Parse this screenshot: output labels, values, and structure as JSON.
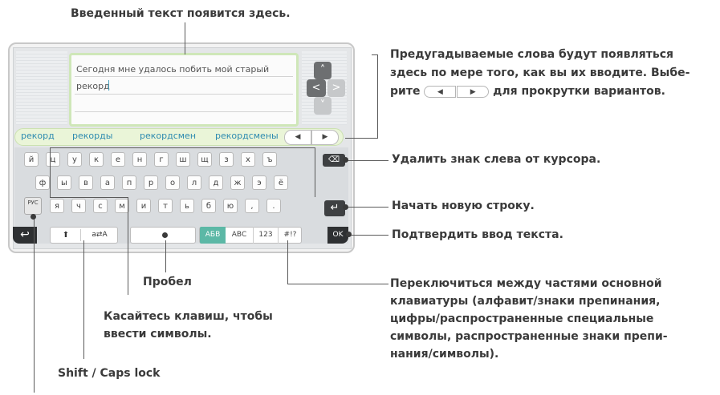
{
  "callouts": {
    "entered_text": "Введенный текст появится здесь.",
    "predicted_1": "Предугадываемые слова будут появляться",
    "predicted_2": "здесь по мере того, как вы их вводите. Выбе-",
    "predicted_3a": "рите",
    "predicted_3b": "для прокрутки вариантов.",
    "delete": "Удалить знак слева от курсора.",
    "newline": "Начать новую строку.",
    "confirm": "Подтвердить ввод текста.",
    "space": "Пробел",
    "switch_1": "Переключиться между частями основной",
    "switch_2": "клавиатуры (алфавит/знаки препинания,",
    "switch_3": "цифры/распространенные специальные",
    "switch_4": "символы, распространенные знаки препи-",
    "switch_5": "нания/символы).",
    "touch_1": "Касайтесь клавиш, чтобы",
    "touch_2": "ввести символы.",
    "shift": "Shift / Caps lock"
  },
  "textbox": {
    "line1": "Сегодня мне удалось побить мой старый",
    "line2": "рекорд"
  },
  "predictions": [
    "рекорд",
    "рекорды",
    "рекордсмен",
    "рекордсмены"
  ],
  "pred_nav": {
    "left": "◀",
    "right": "▶"
  },
  "inline_nav": {
    "left": "◀",
    "right": "▶"
  },
  "dpad": {
    "up": "˄",
    "left": "<",
    "right": ">",
    "down": "˅"
  },
  "keys": {
    "row1": [
      "й",
      "ц",
      "у",
      "к",
      "е",
      "н",
      "г",
      "ш",
      "щ",
      "з",
      "х",
      "ъ"
    ],
    "row2": [
      "ф",
      "ы",
      "в",
      "а",
      "п",
      "р",
      "о",
      "л",
      "д",
      "ж",
      "э",
      "ё"
    ],
    "row3": [
      "я",
      "ч",
      "с",
      "м",
      "и",
      "т",
      "ь",
      "б",
      "ю",
      ",",
      "."
    ]
  },
  "buttons": {
    "backspace": "⌫",
    "enter": "↵",
    "lang": "РУС",
    "back": "↩",
    "shift": "⬆",
    "caps": "a⇄A",
    "ok": "OK"
  },
  "modes": [
    "АБВ",
    "ABC",
    "123",
    "#!?"
  ],
  "colors": {
    "accent_green": "#5cb8a6",
    "prediction_text": "#2e8bb0",
    "callout_text": "#3a3a3a"
  }
}
